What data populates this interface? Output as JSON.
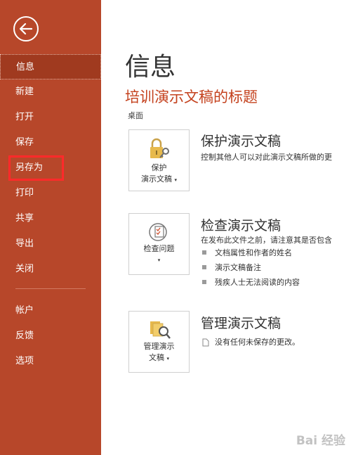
{
  "sidebar": {
    "items": [
      {
        "label": "信息",
        "active": true
      },
      {
        "label": "新建"
      },
      {
        "label": "打开"
      },
      {
        "label": "保存"
      },
      {
        "label": "另存为"
      },
      {
        "label": "打印"
      },
      {
        "label": "共享"
      },
      {
        "label": "导出"
      },
      {
        "label": "关闭"
      }
    ],
    "bottom_items": [
      {
        "label": "帐户"
      },
      {
        "label": "反馈"
      },
      {
        "label": "选项"
      }
    ],
    "accent_color": "#B7472A"
  },
  "main": {
    "page_title": "信息",
    "doc_title": "培训演示文稿的标题",
    "doc_location": "桌面",
    "sections": [
      {
        "button_line1": "保护",
        "button_line2": "演示文稿",
        "icon": "lock-key-icon",
        "title": "保护演示文稿",
        "description": "控制其他人可以对此演示文稿所做的更"
      },
      {
        "button_line1": "检查问题",
        "icon": "inspect-document-icon",
        "title": "检查演示文稿",
        "description": "在发布此文件之前，请注意其是否包含",
        "bullets": [
          "文档属性和作者的姓名",
          "演示文稿备注",
          "残疾人士无法阅读的内容"
        ]
      },
      {
        "button_line1": "管理演示",
        "button_line2": "文稿",
        "icon": "manage-versions-icon",
        "title": "管理演示文稿",
        "status": "没有任何未保存的更改。"
      }
    ]
  },
  "watermark": "Bai 经验"
}
